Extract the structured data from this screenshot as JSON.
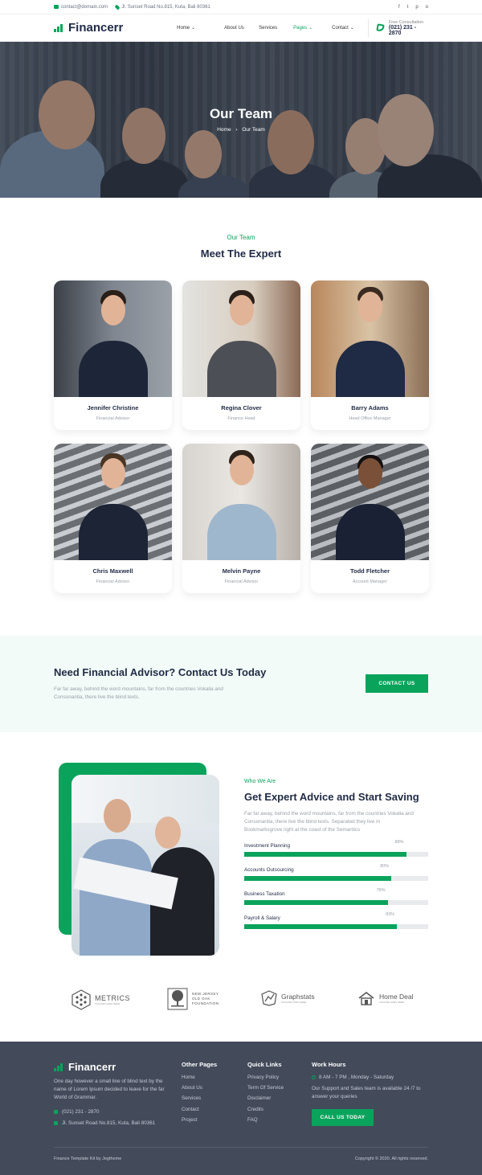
{
  "topbar": {
    "email": "contact@domain.com",
    "address": "Jl. Sunset Road No.815, Kuta, Bali 80361",
    "socials": [
      "f",
      "t",
      "p",
      "o"
    ]
  },
  "nav": {
    "brand": "Financerr",
    "items": [
      "Home",
      "About Us",
      "Services",
      "Pages",
      "Contact"
    ],
    "active": "Pages",
    "phone_label": "Free Consultation",
    "phone": "(021) 231 - 2870"
  },
  "hero": {
    "title": "Our Team",
    "crumb_home": "Home",
    "crumb_sep": "›",
    "crumb_current": "Our Team"
  },
  "team_section": {
    "tag": "Our Team",
    "title": "Meet The Expert",
    "members": [
      {
        "name": "Jennifer Christine",
        "role": "Financial Advisor"
      },
      {
        "name": "Regina Clover",
        "role": "Finance Head"
      },
      {
        "name": "Barry Adams",
        "role": "Head Office Manager"
      },
      {
        "name": "Chris Maxwell",
        "role": "Financial Advisor"
      },
      {
        "name": "Melvin Payne",
        "role": "Financial Advisor"
      },
      {
        "name": "Todd Fletcher",
        "role": "Account Manager"
      }
    ]
  },
  "cta": {
    "title": "Need Financial Advisor? Contact Us Today",
    "text": "Far far away, behind the word mountains, far from the countries Vokalia and Consonantia, there live the blind texts.",
    "button": "CONTACT US"
  },
  "about": {
    "tag": "Who We Are",
    "title": "Get Expert Advice and Start Saving",
    "text": "Far far away, behind the word mountains, far from the countries Vokalia and Consonantia, there live the blind texts. Separated they live in Bookmarksgrove right at the coast of the Semantics",
    "skills": [
      {
        "label": "Investment Planning",
        "percent_text": "88%",
        "value": 88
      },
      {
        "label": "Accounts Outsourcing",
        "percent_text": "80%",
        "value": 80
      },
      {
        "label": "Business Taxation",
        "percent_text": "78%",
        "value": 78
      },
      {
        "label": "Payroll & Salary",
        "percent_text": "83%",
        "value": 83
      }
    ]
  },
  "partners": {
    "metrics": "METRICS",
    "metrics_sub": "TAGLINE GOES HERE",
    "nj_line1": "NEW JERSEY",
    "nj_line2": "OLD OAK",
    "nj_line3": "FOUNDATION",
    "graphstats": "Graphstats",
    "graphstats_sub": "TAGLINE GOES HERE",
    "homedeal": "Home Deal",
    "homedeal_sub": "TAGLINE GOES HERE"
  },
  "footer": {
    "brand": "Financerr",
    "about": "One day however a small line of blind text by the name of Lorem Ipsum decided to leave for the far World of Grammar.",
    "phone": "(021) 231 - 2870",
    "address": "Jl. Sunset Road No.815, Kuta, Bali 80361",
    "col1_title": "Other Pages",
    "col1": [
      "Home",
      "About Us",
      "Services",
      "Contact",
      "Project"
    ],
    "col2_title": "Quick Links",
    "col2": [
      "Privacy Policy",
      "Term Of Service",
      "Disclaimer",
      "Credits",
      "FAQ"
    ],
    "col3_title": "Work Hours",
    "hours": "8 AM - 7 PM , Monday - Saturday",
    "support": "Our Support and Sales team is available 24 /7 to answer your queries",
    "button": "CALL US TODAY",
    "credit": "Finance Template Kit by Jegtheme",
    "copyright": "Copyright © 2020. All rights reserved."
  },
  "colors": {
    "accent": "#0aa35c",
    "footer_bg": "#434a5a",
    "cta_bg": "#f2fbf8",
    "text": "#1f2a44"
  }
}
